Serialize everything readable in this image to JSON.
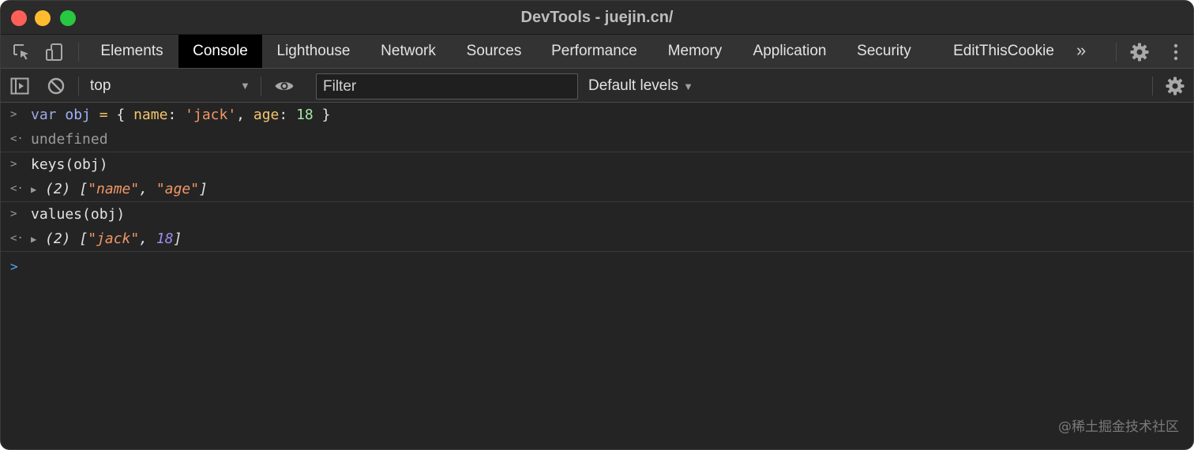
{
  "window": {
    "title": "DevTools - juejin.cn/"
  },
  "tabs": [
    {
      "label": "Elements",
      "active": false
    },
    {
      "label": "Console",
      "active": true
    },
    {
      "label": "Lighthouse",
      "active": false
    },
    {
      "label": "Network",
      "active": false
    },
    {
      "label": "Sources",
      "active": false
    },
    {
      "label": "Performance",
      "active": false
    },
    {
      "label": "Memory",
      "active": false
    },
    {
      "label": "Application",
      "active": false
    },
    {
      "label": "Security",
      "active": false
    },
    {
      "label": "EditThisCookie",
      "active": false
    }
  ],
  "more_tabs_label": "»",
  "console_toolbar": {
    "context": "top",
    "filter_placeholder": "Filter",
    "levels": "Default levels"
  },
  "console": {
    "entries": [
      {
        "input": {
          "kw": "var",
          "name": "obj",
          "eq": "=",
          "open": "{",
          "k1": "name",
          "colon1": ":",
          "v1": "'jack'",
          "comma": ",",
          "k2": "age",
          "colon2": ":",
          "v2": "18",
          "close": "}"
        },
        "output": "undefined"
      },
      {
        "input": "keys(obj)",
        "output": {
          "count": "(2)",
          "open": "[",
          "a": "\"name\"",
          "sep": ",",
          "b": "\"age\"",
          "close": "]"
        }
      },
      {
        "input": "values(obj)",
        "output": {
          "count": "(2)",
          "open": "[",
          "a": "\"jack\"",
          "sep": ",",
          "b": "18",
          "close": "]"
        }
      }
    ]
  },
  "watermark": "@稀土掘金技术社区",
  "colors": {
    "background": "#242424",
    "toolbar": "#333333",
    "active_tab": "#000000",
    "string": "#f29766",
    "property": "#f5c56b",
    "number": "#a4e6a4",
    "prompt_active": "#5ea2ff"
  }
}
